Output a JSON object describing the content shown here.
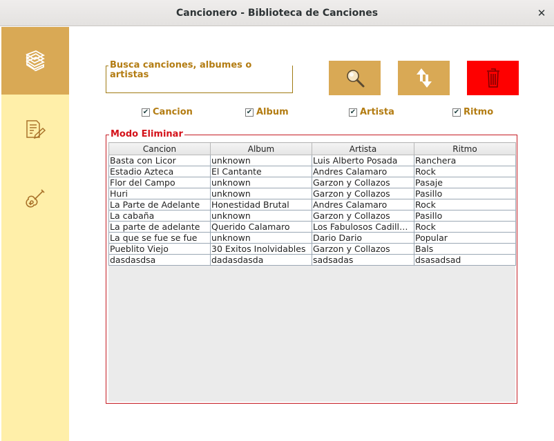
{
  "window": {
    "title": "Cancionero - Biblioteca de Canciones",
    "close_glyph": "✕"
  },
  "sidebar": {
    "items": [
      {
        "icon": "library-books-icon",
        "active": true
      },
      {
        "icon": "edit-document-icon",
        "active": false
      },
      {
        "icon": "guitar-icon",
        "active": false
      }
    ]
  },
  "search": {
    "legend": "Busca canciones, albumes o artistas",
    "value": "",
    "placeholder": ""
  },
  "buttons": {
    "search": {
      "icon": "magnifier-icon",
      "color": "#d9a955"
    },
    "swap": {
      "icon": "swap-arrows-icon",
      "color": "#d9a955"
    },
    "delete": {
      "icon": "trash-icon",
      "color": "#fe0000"
    }
  },
  "filters": [
    {
      "label": "Cancion",
      "checked": true
    },
    {
      "label": "Album",
      "checked": true
    },
    {
      "label": "Artista",
      "checked": true
    },
    {
      "label": "Ritmo",
      "checked": true
    }
  ],
  "panel": {
    "legend": "Modo Eliminar"
  },
  "table": {
    "columns": [
      "Cancion",
      "Album",
      "Artista",
      "Ritmo"
    ],
    "rows": [
      [
        "Basta con Licor",
        "unknown",
        "Luis Alberto Posada",
        "Ranchera"
      ],
      [
        "Estadio Azteca",
        "El Cantante",
        "Andres Calamaro",
        "Rock"
      ],
      [
        "Flor del Campo",
        "unknown",
        "Garzon y Collazos",
        "Pasaje"
      ],
      [
        "Huri",
        "unknown",
        "Garzon y Collazos",
        "Pasillo"
      ],
      [
        "La Parte de Adelante",
        "Honestidad Brutal",
        "Andres Calamaro",
        "Rock"
      ],
      [
        "La cabaña",
        "unknown",
        "Garzon y Collazos",
        "Pasillo"
      ],
      [
        "La parte de adelante",
        "Querido Calamaro",
        "Los Fabulosos Cadill…",
        "Rock"
      ],
      [
        "La que se fue se fue",
        "unknown",
        "Dario Dario",
        "Popular"
      ],
      [
        "Pueblito Viejo",
        "30 Exitos Inolvidables",
        "Garzon y Collazos",
        "Bals"
      ],
      [
        "dasdasdsa",
        "dadasdasda",
        "sadsadas",
        "dsasadsad"
      ]
    ]
  },
  "colors": {
    "accent": "#d9a955",
    "sidebar": "#ffefa9",
    "danger": "#fe0000",
    "label": "#b37c12",
    "panel_border": "#c41b22"
  }
}
